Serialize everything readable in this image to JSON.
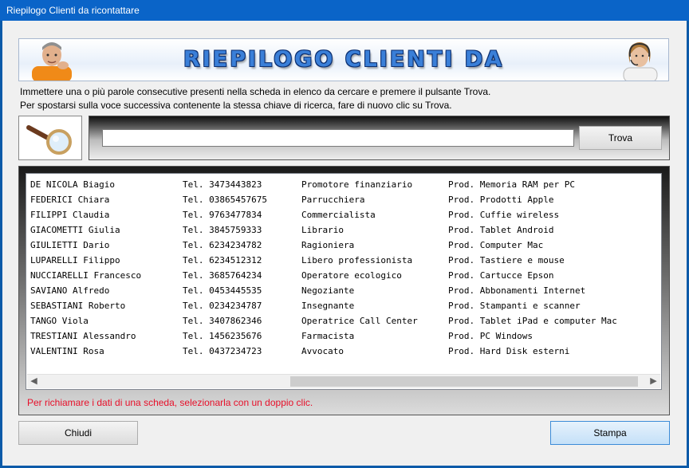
{
  "window": {
    "title": "Riepilogo Clienti da ricontattare"
  },
  "banner": {
    "title": "RIEPILOGO CLIENTI DA RICONTATTARE"
  },
  "instructions": {
    "line1": "Immettere una o più parole consecutive presenti nella scheda in elenco da cercare e premere il pulsante Trova.",
    "line2": "Per spostarsi sulla voce successiva contenente la stessa chiave di ricerca, fare di nuovo clic su Trova."
  },
  "search": {
    "value": "",
    "find_label": "Trova"
  },
  "list": {
    "rows": [
      {
        "name": "DE NICOLA Biagio",
        "phone": "Tel. 3473443823",
        "job": "Promotore finanziario",
        "product": "Prod. Memoria RAM per PC"
      },
      {
        "name": "FEDERICI Chiara",
        "phone": "Tel. 03865457675",
        "job": "Parrucchiera",
        "product": "Prod. Prodotti Apple"
      },
      {
        "name": "FILIPPI Claudia",
        "phone": "Tel. 9763477834",
        "job": "Commercialista",
        "product": "Prod. Cuffie wireless"
      },
      {
        "name": "GIACOMETTI Giulia",
        "phone": "Tel. 3845759333",
        "job": "Librario",
        "product": "Prod. Tablet Android"
      },
      {
        "name": "GIULIETTI Dario",
        "phone": "Tel. 6234234782",
        "job": "Ragioniera",
        "product": "Prod. Computer Mac"
      },
      {
        "name": "LUPARELLI Filippo",
        "phone": "Tel. 6234512312",
        "job": "Libero professionista",
        "product": "Prod. Tastiere e mouse"
      },
      {
        "name": "NUCCIARELLI Francesco",
        "phone": "Tel. 3685764234",
        "job": "Operatore ecologico",
        "product": "Prod. Cartucce Epson"
      },
      {
        "name": "SAVIANO Alfredo",
        "phone": "Tel. 0453445535",
        "job": "Negoziante",
        "product": "Prod. Abbonamenti Internet"
      },
      {
        "name": "SEBASTIANI Roberto",
        "phone": "Tel. 0234234787",
        "job": "Insegnante",
        "product": "Prod. Stampanti e scanner"
      },
      {
        "name": "TANGO Viola",
        "phone": "Tel. 3407862346",
        "job": "Operatrice Call Center",
        "product": "Prod. Tablet iPad e computer Mac"
      },
      {
        "name": "TRESTIANI Alessandro",
        "phone": "Tel. 1456235676",
        "job": "Farmacista",
        "product": "Prod. PC Windows"
      },
      {
        "name": "VALENTINI Rosa",
        "phone": "Tel. 0437234723",
        "job": "Avvocato",
        "product": "Prod. Hard Disk esterni"
      }
    ],
    "hint": "Per richiamare i dati di una scheda, selezionarla con un doppio clic."
  },
  "buttons": {
    "close": "Chiudi",
    "print": "Stampa"
  },
  "icons": {
    "search": "magnifier-icon",
    "scroll_left": "chevron-left-icon",
    "scroll_right": "chevron-right-icon",
    "left_person": "man-portrait-icon",
    "right_person": "operator-headset-portrait-icon"
  },
  "colors": {
    "titlebar": "#0a64c8",
    "hint": "#e8102a",
    "banner_text": "#3a7fd8"
  }
}
